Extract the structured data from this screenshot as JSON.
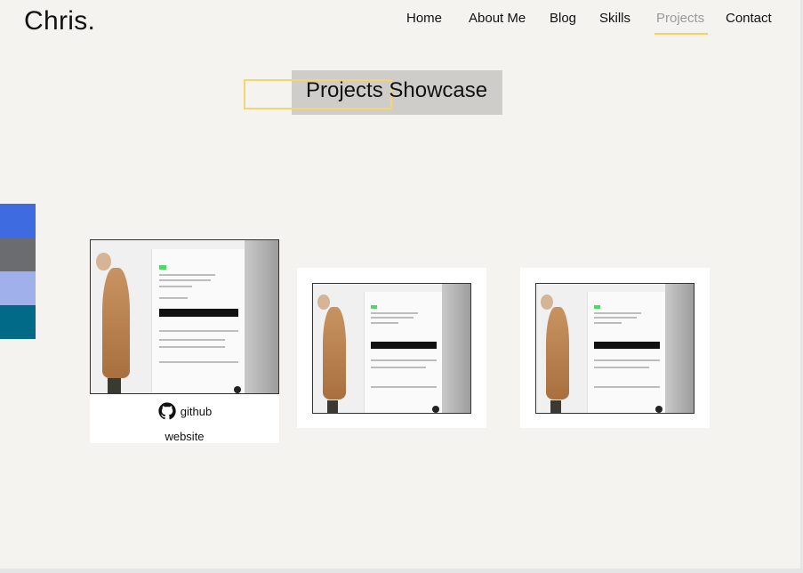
{
  "brand": {
    "logo": "Chris."
  },
  "nav": {
    "items": [
      {
        "label": "Home",
        "active": false
      },
      {
        "label": "About Me",
        "active": false
      },
      {
        "label": "Blog",
        "active": false
      },
      {
        "label": "Skills",
        "active": false
      },
      {
        "label": "Projects",
        "active": true
      },
      {
        "label": "Contact",
        "active": false
      }
    ],
    "active_color": "#9a9a9a",
    "underline_color": "#f5d35b"
  },
  "hero": {
    "title": "Projects Showcase"
  },
  "swatches": [
    "#3f6be0",
    "#6a6c70",
    "#9fb0ea",
    "#006a88"
  ],
  "projects": [
    {
      "image": "product-page-screenshot",
      "links": {
        "github": "github",
        "website": "website"
      },
      "hovered": true
    },
    {
      "image": "product-page-screenshot",
      "hovered": false
    },
    {
      "image": "product-page-screenshot",
      "hovered": false
    }
  ],
  "icons": {
    "github": "github-icon"
  }
}
